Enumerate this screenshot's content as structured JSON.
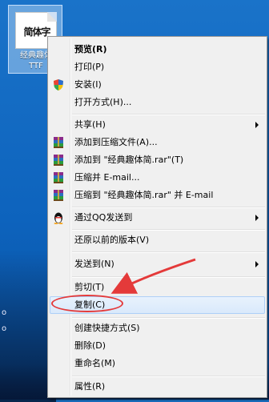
{
  "desktop": {
    "file": {
      "glyph_text": "简体字",
      "name_line1": "经典趣体",
      "name_line2": "TTF"
    },
    "left_glyph_1": "o",
    "left_glyph_2": "o"
  },
  "menu": {
    "items": [
      {
        "label": "预览(R)",
        "icon": null,
        "bold": true
      },
      {
        "label": "打印(P)",
        "icon": null
      },
      {
        "label": "安装(I)",
        "icon": "shield-icon"
      },
      {
        "label": "打开方式(H)...",
        "icon": null
      },
      {
        "label": "共享(H)",
        "icon": null,
        "submenu": true
      },
      {
        "label": "添加到压缩文件(A)...",
        "icon": "winrar-icon"
      },
      {
        "label": "添加到 \"经典趣体简.rar\"(T)",
        "icon": "winrar-icon"
      },
      {
        "label": "压缩并 E-mail...",
        "icon": "winrar-icon"
      },
      {
        "label": "压缩到 \"经典趣体简.rar\" 并 E-mail",
        "icon": "winrar-icon"
      },
      {
        "label": "通过QQ发送到",
        "icon": "qq-penguin-icon",
        "submenu": true
      },
      {
        "label": "还原以前的版本(V)",
        "icon": null
      },
      {
        "label": "发送到(N)",
        "icon": null,
        "submenu": true
      },
      {
        "label": "剪切(T)",
        "icon": null
      },
      {
        "label": "复制(C)",
        "icon": null,
        "highlighted": true
      },
      {
        "label": "创建快捷方式(S)",
        "icon": null
      },
      {
        "label": "删除(D)",
        "icon": null
      },
      {
        "label": "重命名(M)",
        "icon": null
      },
      {
        "label": "属性(R)",
        "icon": null
      }
    ]
  },
  "colors": {
    "desktop_blue": "#0d63bd",
    "menu_bg": "#f0f0f0",
    "highlight": "#d9e9fb",
    "annotation_red": "#e43a3a"
  }
}
